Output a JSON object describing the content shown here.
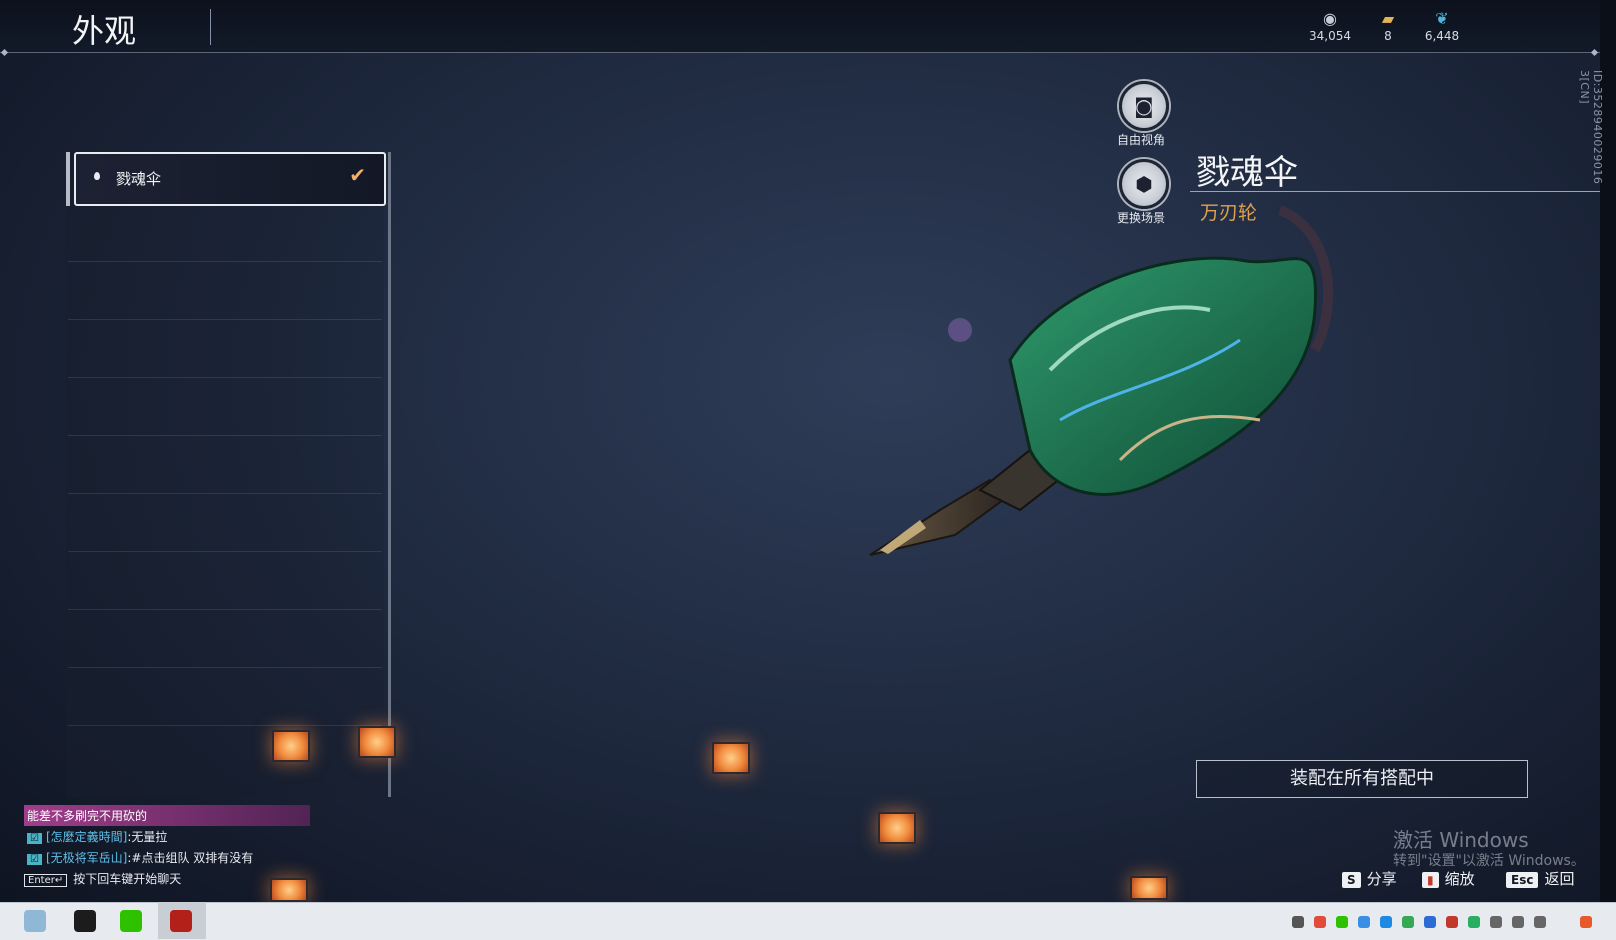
{
  "header": {
    "title": "外观",
    "currencies": [
      {
        "icon": "coin-icon",
        "value": "34,054"
      },
      {
        "icon": "ticket-icon",
        "value": "8"
      },
      {
        "icon": "feather-icon",
        "value": "6,448"
      }
    ]
  },
  "side_id": "ID:3528940029016 3[CN]",
  "list": {
    "selected_item": "戮魂伞"
  },
  "view_controls": {
    "free_camera_label": "自由视角",
    "change_scene_label": "更换场景"
  },
  "item": {
    "name": "戮魂伞",
    "type": "万刃轮"
  },
  "equip_button": "装配在所有搭配中",
  "watermark": {
    "line1": "激活 Windows",
    "line2": "转到\"设置\"以激活 Windows。"
  },
  "hotkeys": [
    {
      "key": "S",
      "label": "分享"
    },
    {
      "key": "",
      "label": "缩放"
    },
    {
      "key": "Esc",
      "label": "返回"
    }
  ],
  "chat": {
    "highlight": "能差不多刷完不用砍的",
    "lines": [
      {
        "name": "[怎麼定義時間]",
        "text": ":无量拉"
      },
      {
        "name": "[无极将军岳山]",
        "text": ":#点击组队 双排有没有"
      }
    ],
    "enter_key": "Enter↵",
    "enter_hint": "按下回车键开始聊天"
  },
  "colors": {
    "accent_gold": "#e0a24a",
    "check_orange": "#f0b16a",
    "background": "#1f2a40"
  }
}
